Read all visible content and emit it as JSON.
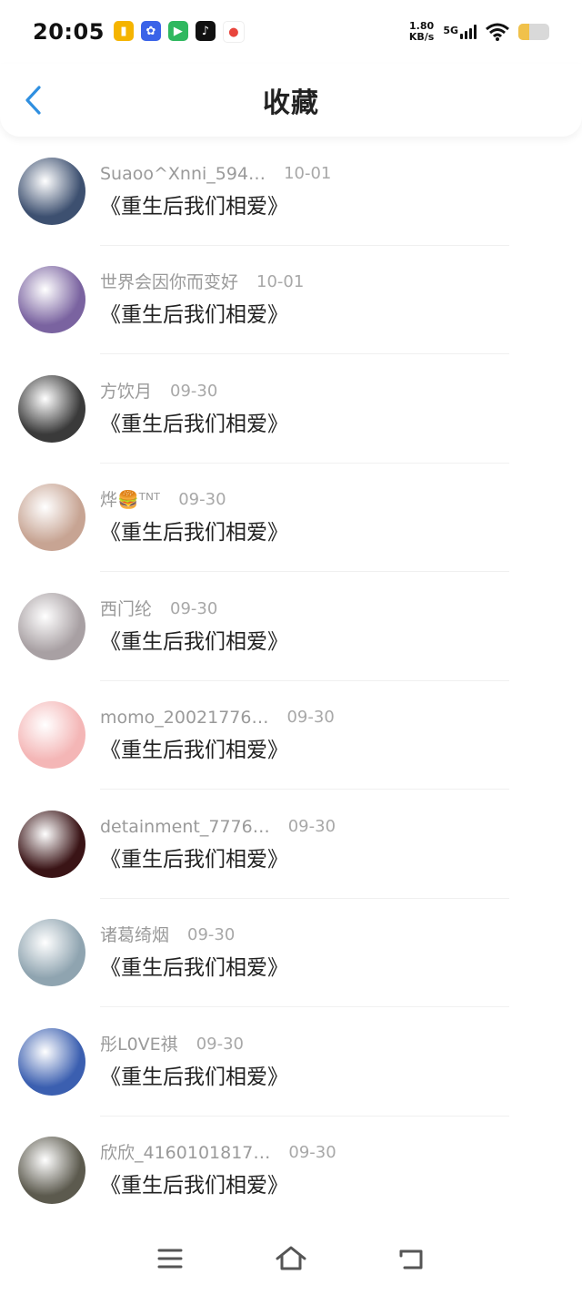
{
  "status_bar": {
    "time": "20:05",
    "net_speed_value": "1.80",
    "net_speed_unit": "KB/s",
    "network_type": "5G",
    "battery_level": 0.35,
    "app_icons": [
      {
        "name": "notes-app-icon",
        "color": "#f5b400"
      },
      {
        "name": "baidu-app-icon",
        "color": "#3a63e8"
      },
      {
        "name": "video-app-icon",
        "color": "#2fb85f"
      },
      {
        "name": "tiktok-app-icon",
        "color": "#111111"
      },
      {
        "name": "map-app-icon",
        "color": "#e8453c"
      }
    ]
  },
  "header": {
    "title": "收藏",
    "accent": "#2f8fe0"
  },
  "items": [
    {
      "username": "Suaoo^Xnni_594…",
      "date": "10-01",
      "book": "《重生后我们相爱》",
      "avatar_color": "#3d5070"
    },
    {
      "username": "世界会因你而变好",
      "date": "10-01",
      "book": "《重生后我们相爱》",
      "avatar_color": "#7a63a0"
    },
    {
      "username": "方饮月",
      "date": "09-30",
      "book": "《重生后我们相爱》",
      "avatar_color": "#3a3a3a"
    },
    {
      "username": "烨🍔ᵀᴺᵀ",
      "date": "09-30",
      "book": "《重生后我们相爱》",
      "avatar_color": "#c7a493"
    },
    {
      "username": "西门纶",
      "date": "09-30",
      "book": "《重生后我们相爱》",
      "avatar_color": "#a8a0a3"
    },
    {
      "username": "momo_20021776…",
      "date": "09-30",
      "book": "《重生后我们相爱》",
      "avatar_color": "#f4b6b6"
    },
    {
      "username": "detainment_7776…",
      "date": "09-30",
      "book": "《重生后我们相爱》",
      "avatar_color": "#3a1416"
    },
    {
      "username": "诸葛绮烟",
      "date": "09-30",
      "book": "《重生后我们相爱》",
      "avatar_color": "#8fa4b0"
    },
    {
      "username": "彤L0VE祺",
      "date": "09-30",
      "book": "《重生后我们相爱》",
      "avatar_color": "#3b5fb0"
    },
    {
      "username": "欣欣_4160101817…",
      "date": "09-30",
      "book": "《重生后我们相爱》",
      "avatar_color": "#5c5a4e"
    }
  ],
  "nav_bar": {
    "menu_icon": "menu-icon",
    "home_icon": "home-icon",
    "back_icon": "back-icon",
    "icon_color": "#555555"
  }
}
